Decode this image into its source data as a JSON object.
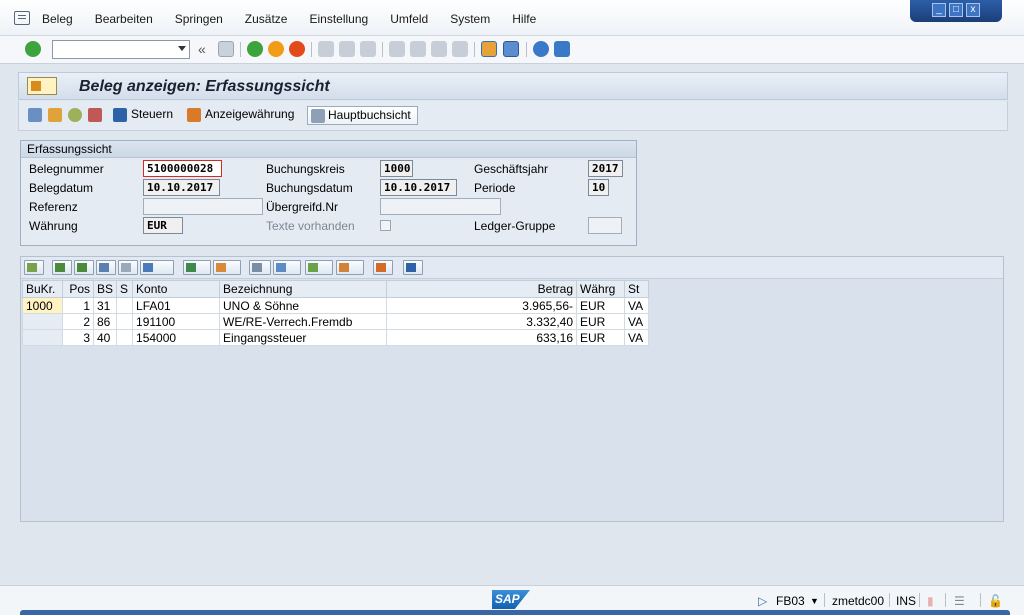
{
  "menu": {
    "items": [
      "Beleg",
      "Bearbeiten",
      "Springen",
      "Zusätze",
      "Einstellung",
      "Umfeld",
      "System",
      "Hilfe"
    ]
  },
  "window_controls": {
    "minimize": "_",
    "maximize": "□",
    "close": "x"
  },
  "toolbar": {
    "command_field_value": "",
    "back_symbol": "«"
  },
  "title": "Beleg anzeigen: Erfassungssicht",
  "app_toolbar": {
    "steuern_label": "Steuern",
    "anzeigewaehrung_label": "Anzeigewährung",
    "hauptbuchsicht_label": "Hauptbuchsicht"
  },
  "form": {
    "group_title": "Erfassungssicht",
    "belegnummer_label": "Belegnummer",
    "belegnummer_value": "5100000028",
    "buchungskreis_label": "Buchungskreis",
    "buchungskreis_value": "1000",
    "geschaeftsjahr_label": "Geschäftsjahr",
    "geschaeftsjahr_value": "2017",
    "belegdatum_label": "Belegdatum",
    "belegdatum_value": "10.10.2017",
    "buchungsdatum_label": "Buchungsdatum",
    "buchungsdatum_value": "10.10.2017",
    "periode_label": "Periode",
    "periode_value": "10",
    "referenz_label": "Referenz",
    "referenz_value": "",
    "uebergreifd_label": "Übergreifd.Nr",
    "uebergreifd_value": "",
    "waehrung_label": "Währung",
    "waehrung_value": "EUR",
    "texte_label": "Texte vorhanden",
    "ledger_label": "Ledger-Gruppe",
    "ledger_value": ""
  },
  "grid": {
    "columns": [
      "BuKr.",
      "Pos",
      "BS",
      "S",
      "Konto",
      "Bezeichnung",
      "Betrag",
      "Währg",
      "St"
    ],
    "rows": [
      {
        "bukr": "1000",
        "pos": "1",
        "bs": "31",
        "s": "",
        "konto": "LFA01",
        "bezeichnung": "UNO & Söhne",
        "betrag": "3.965,56-",
        "waehrg": "EUR",
        "st": "VA"
      },
      {
        "bukr": "",
        "pos": "2",
        "bs": "86",
        "s": "",
        "konto": "191100",
        "bezeichnung": "WE/RE-Verrech.Fremdb",
        "betrag": "3.332,40",
        "waehrg": "EUR",
        "st": "VA"
      },
      {
        "bukr": "",
        "pos": "3",
        "bs": "40",
        "s": "",
        "konto": "154000",
        "bezeichnung": "Eingangssteuer",
        "betrag": "633,16",
        "waehrg": "EUR",
        "st": "VA"
      }
    ]
  },
  "status": {
    "logo": "SAP",
    "transaction": "FB03",
    "server": "zmetdc00",
    "mode": "INS"
  },
  "colors": {
    "accent_blue": "#1361b0",
    "key_cell": "#fff3c2",
    "focus_border": "#d52b1e",
    "ok_green": "#3da33d",
    "exit_red": "#e24a1a",
    "back_orange": "#f29b17"
  }
}
